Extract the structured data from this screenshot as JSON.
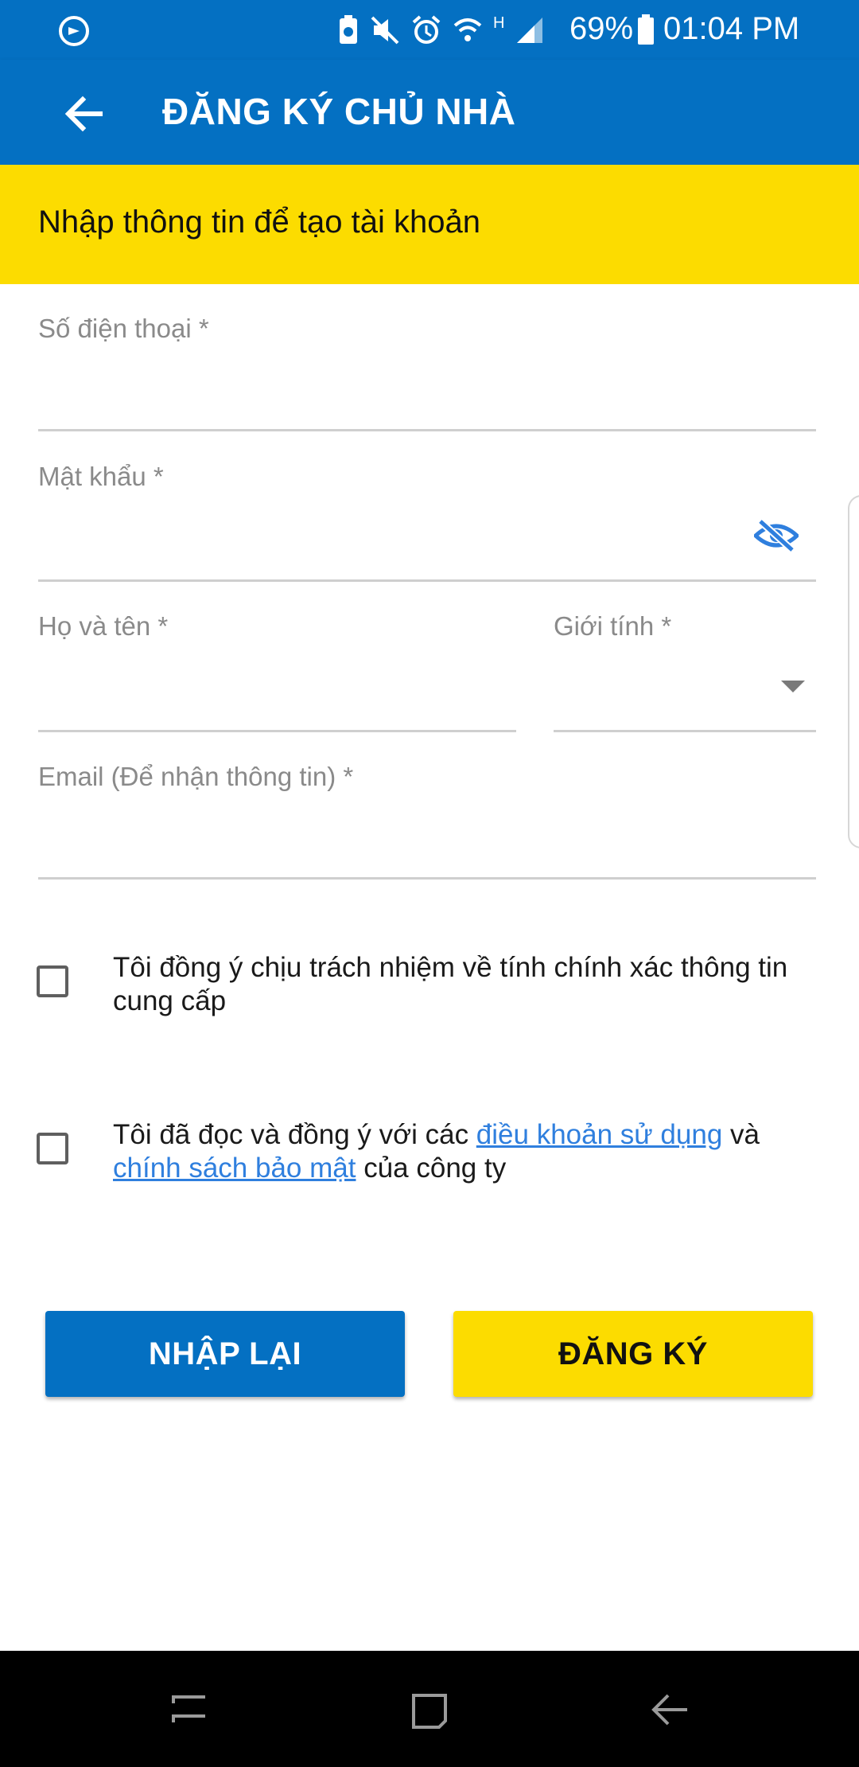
{
  "status_bar": {
    "battery": "69%",
    "time": "01:04 PM",
    "network_type": "H"
  },
  "app_bar": {
    "title": "ĐĂNG KÝ CHỦ NHÀ"
  },
  "banner": {
    "text": "Nhập thông tin để tạo tài khoản"
  },
  "form": {
    "phone_label": "Số điện thoại *",
    "password_label": "Mật khẩu *",
    "fullname_label": "Họ và tên *",
    "gender_label": "Giới tính *",
    "email_label": "Email (Để nhận thông tin) *",
    "phone_value": "",
    "password_value": "",
    "fullname_value": "",
    "email_value": ""
  },
  "agreements": {
    "accuracy_text": "Tôi đồng ý chịu trách nhiệm về tính chính xác thông tin cung cấp",
    "terms_prefix": "Tôi đã đọc và đồng ý với các ",
    "terms_link": "điều khoản sử dụng",
    "terms_mid": " và ",
    "privacy_link": "chính sách bảo mật",
    "terms_suffix": " của công ty"
  },
  "buttons": {
    "reset": "NHẬP LẠI",
    "register": "ĐĂNG KÝ"
  },
  "colors": {
    "primary_blue": "#0470c2",
    "accent_yellow": "#fcdc00",
    "link_blue": "#2f7fde"
  }
}
